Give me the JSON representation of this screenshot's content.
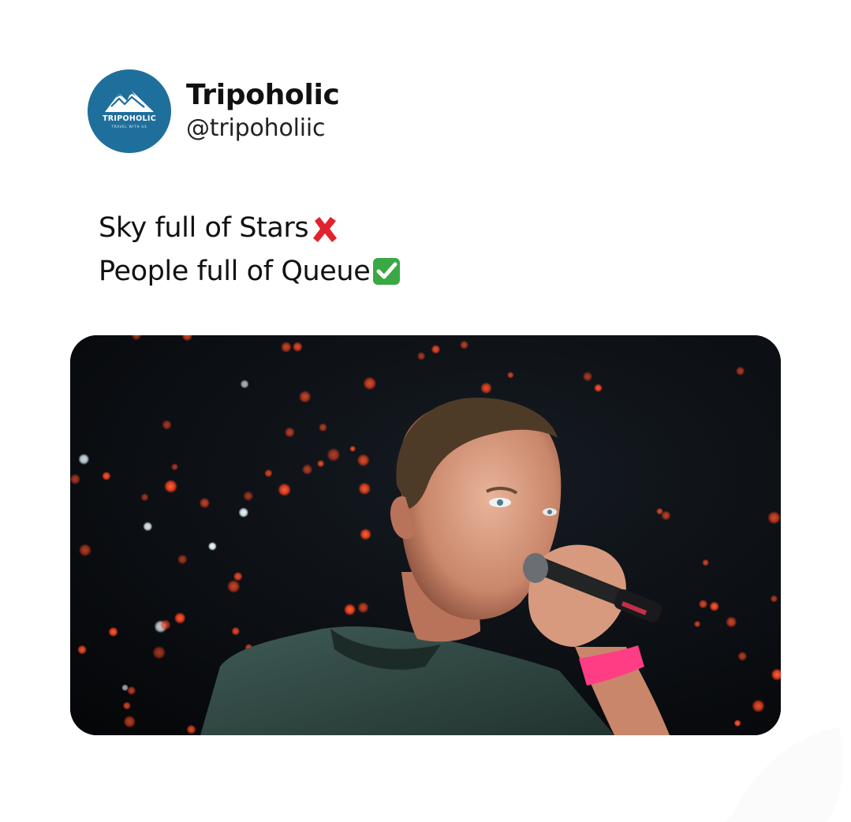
{
  "post": {
    "display_name": "Tripoholic",
    "handle": "@tripoholiic",
    "avatar": {
      "brand": "TRIPOHOLIC",
      "tagline": "TRAVEL WITH US",
      "background": "#1f6f9c"
    },
    "text_lines": [
      {
        "text": "Sky full of Stars",
        "emoji": "cross-mark-icon"
      },
      {
        "text": "People full of Queue",
        "emoji": "check-mark-button-icon"
      }
    ],
    "image": {
      "description_icon": "concert-singer-photo"
    }
  },
  "colors": {
    "background": "#ffffff",
    "text": "#111111",
    "cross": "#e0242f",
    "check": "#3aa845",
    "avatar": "#1f6f9c"
  }
}
